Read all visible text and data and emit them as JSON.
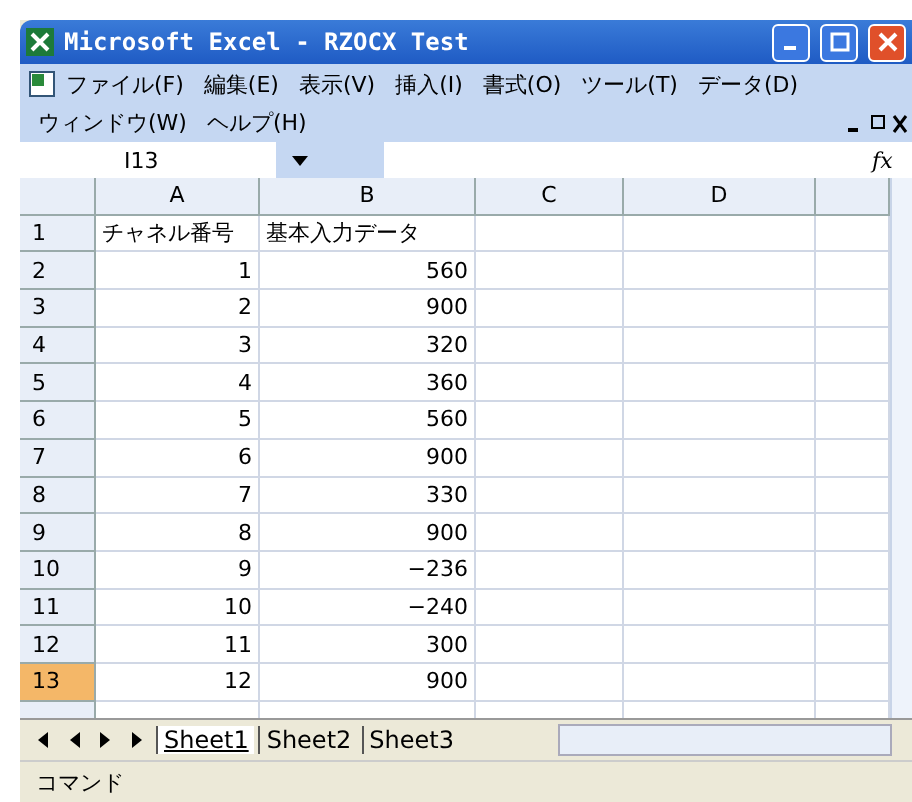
{
  "window": {
    "title": "Microsoft Excel - RZOCX Test"
  },
  "menu": [
    {
      "label": "ファイル(F)"
    },
    {
      "label": "編集(E)"
    },
    {
      "label": "表示(V)"
    },
    {
      "label": "挿入(I)"
    },
    {
      "label": "書式(O)"
    },
    {
      "label": "ツール(T)"
    },
    {
      "label": "データ(D)"
    },
    {
      "label": "ウィンドウ(W)"
    },
    {
      "label": "ヘルプ(H)"
    }
  ],
  "name_box": "I13",
  "formula_label": "fx",
  "columns": [
    {
      "label": "A"
    },
    {
      "label": "B"
    },
    {
      "label": "C"
    },
    {
      "label": "D"
    }
  ],
  "rows": [
    {
      "header": "1",
      "selected": false,
      "cells": [
        "チャネル番号",
        "基本入力データ"
      ]
    },
    {
      "header": "2",
      "selected": false,
      "cells": [
        "1",
        "560"
      ]
    },
    {
      "header": "3",
      "selected": false,
      "cells": [
        "2",
        "900"
      ]
    },
    {
      "header": "4",
      "selected": false,
      "cells": [
        "3",
        "320"
      ]
    },
    {
      "header": "5",
      "selected": false,
      "cells": [
        "4",
        "360"
      ]
    },
    {
      "header": "6",
      "selected": false,
      "cells": [
        "5",
        "560"
      ]
    },
    {
      "header": "7",
      "selected": false,
      "cells": [
        "6",
        "900"
      ]
    },
    {
      "header": "8",
      "selected": false,
      "cells": [
        "7",
        "330"
      ]
    },
    {
      "header": "9",
      "selected": false,
      "cells": [
        "8",
        "900"
      ]
    },
    {
      "header": "10",
      "selected": false,
      "cells": [
        "9",
        "−236"
      ]
    },
    {
      "header": "11",
      "selected": false,
      "cells": [
        "10",
        "−240"
      ]
    },
    {
      "header": "12",
      "selected": false,
      "cells": [
        "11",
        "300"
      ]
    },
    {
      "header": "13",
      "selected": true,
      "cells": [
        "12",
        "900"
      ]
    }
  ],
  "sheet_tabs": [
    {
      "label": "Sheet1",
      "selected": true
    },
    {
      "label": "Sheet2",
      "selected": false
    },
    {
      "label": "Sheet3",
      "selected": false
    }
  ],
  "status_bar": {
    "text": "コマンド"
  }
}
